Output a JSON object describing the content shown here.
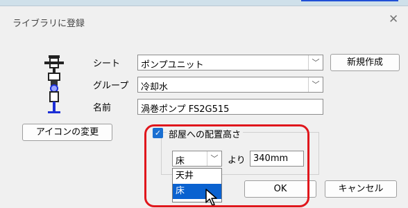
{
  "window": {
    "title": "ライブラリに登録",
    "close_glyph": "✕"
  },
  "form": {
    "sheet_label": "シート",
    "sheet_value": "ポンプユニット",
    "group_label": "グループ",
    "group_value": "冷却水",
    "name_label": "名前",
    "name_value": "渦巻ポンプ FS2G515"
  },
  "buttons": {
    "new_create": "新規作成",
    "change_icon": "アイコンの変更",
    "ok": "OK",
    "cancel": "キャンセル"
  },
  "height_option": {
    "checkbox_label": "部屋への配置高さ",
    "checked": true,
    "reference_value": "床",
    "from_label": "より",
    "height_value": "340mm",
    "options": [
      "天井",
      "床"
    ],
    "selected_option": "床"
  },
  "icons": {
    "dropdown_arrow": "﹀",
    "check": "✓"
  },
  "colors": {
    "accent": "#0a62d0",
    "highlight": "#e0161c"
  }
}
